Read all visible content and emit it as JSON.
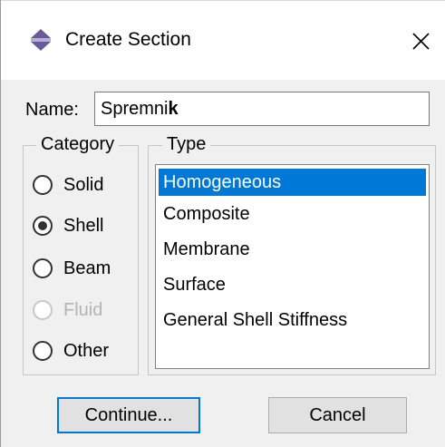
{
  "dialog": {
    "title": "Create Section",
    "close_glyph": "✕",
    "icon": "create-section-icon"
  },
  "name": {
    "label": "Name:",
    "value": "Spremnik",
    "value_plain": "Spremni",
    "value_bold": "k"
  },
  "category": {
    "legend": "Category",
    "options": [
      {
        "label": "Solid",
        "checked": false,
        "enabled": true
      },
      {
        "label": "Shell",
        "checked": true,
        "enabled": true
      },
      {
        "label": "Beam",
        "checked": false,
        "enabled": true
      },
      {
        "label": "Fluid",
        "checked": false,
        "enabled": false
      },
      {
        "label": "Other",
        "checked": false,
        "enabled": true
      }
    ]
  },
  "type": {
    "legend": "Type",
    "items": [
      {
        "label": "Homogeneous",
        "selected": true
      },
      {
        "label": "Composite",
        "selected": false
      },
      {
        "label": "Membrane",
        "selected": false
      },
      {
        "label": "Surface",
        "selected": false
      },
      {
        "label": "General Shell Stiffness",
        "selected": false
      }
    ]
  },
  "buttons": {
    "continue_label": "Continue...",
    "cancel_label": "Cancel"
  },
  "colors": {
    "selection": "#0078d7",
    "dialog_bg": "#f0f0f0",
    "icon_purple": "#6a5a9c"
  }
}
